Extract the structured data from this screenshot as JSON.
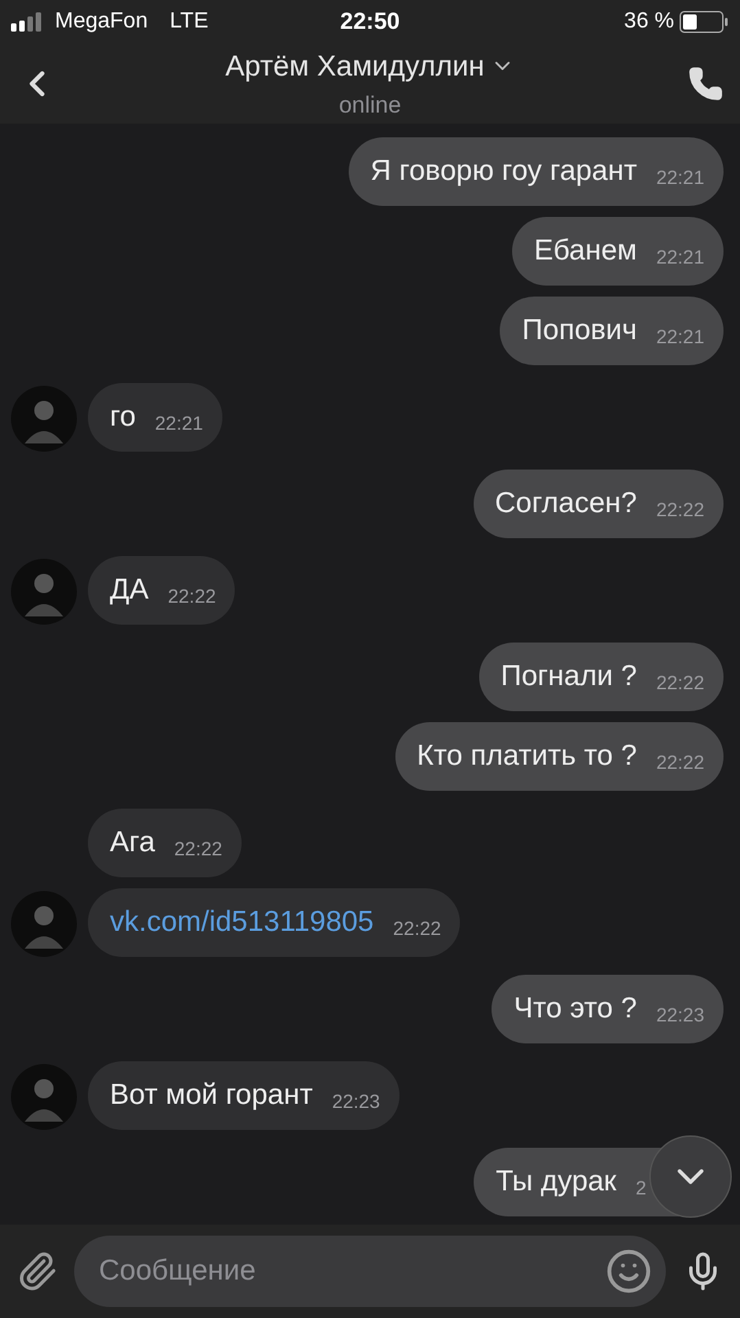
{
  "status_bar": {
    "carrier": "MegaFon",
    "network": "LTE",
    "time": "22:50",
    "battery": "36 %"
  },
  "header": {
    "title": "Артём Хамидуллин",
    "subtitle": "online"
  },
  "messages": [
    {
      "kind": "outgoing",
      "link": false,
      "text": "Я говорю гоу гарант",
      "time": "22:21"
    },
    {
      "kind": "outgoing",
      "link": false,
      "text": "Ебанем",
      "time": "22:21"
    },
    {
      "kind": "outgoing",
      "link": false,
      "text": "Попович",
      "time": "22:21"
    },
    {
      "kind": "incoming",
      "link": false,
      "text": "го",
      "time": "22:21",
      "avatar": true
    },
    {
      "kind": "outgoing",
      "link": false,
      "text": "Согласен?",
      "time": "22:22"
    },
    {
      "kind": "incoming",
      "link": false,
      "text": "ДА",
      "time": "22:22",
      "avatar": true
    },
    {
      "kind": "outgoing",
      "link": false,
      "text": "Погнали ?",
      "time": "22:22"
    },
    {
      "kind": "outgoing",
      "link": false,
      "text": "Кто платить то ?",
      "time": "22:22"
    },
    {
      "kind": "incoming",
      "link": false,
      "text": "Ага",
      "time": "22:22",
      "avatar": false
    },
    {
      "kind": "incoming",
      "link": true,
      "text": "vk.com/id513119805",
      "time": "22:22",
      "avatar": true
    },
    {
      "kind": "outgoing",
      "link": false,
      "text": "Что это ?",
      "time": "22:23"
    },
    {
      "kind": "incoming",
      "link": false,
      "text": "Вот мой горант",
      "time": "22:23",
      "avatar": true
    },
    {
      "kind": "outgoing",
      "link": false,
      "text": "Ты дурак",
      "time": "2"
    }
  ],
  "composer": {
    "placeholder": "Сообщение"
  }
}
